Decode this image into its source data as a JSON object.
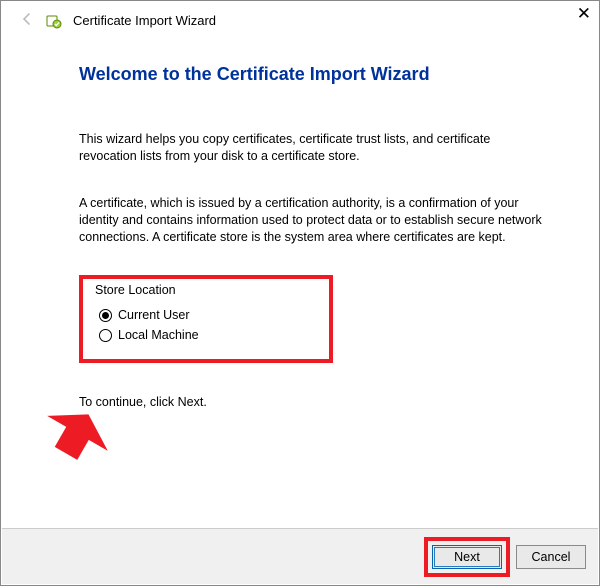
{
  "window": {
    "title": "Certificate Import Wizard"
  },
  "main": {
    "heading": "Welcome to the Certificate Import Wizard",
    "para1": "This wizard helps you copy certificates, certificate trust lists, and certificate revocation lists from your disk to a certificate store.",
    "para2": "A certificate, which is issued by a certification authority, is a confirmation of your identity and contains information used to protect data or to establish secure network connections. A certificate store is the system area where certificates are kept.",
    "store_location": {
      "legend": "Store Location",
      "options": [
        {
          "label": "Current User",
          "selected": true
        },
        {
          "label": "Local Machine",
          "selected": false
        }
      ]
    },
    "continue_hint": "To continue, click Next."
  },
  "footer": {
    "next": "Next",
    "cancel": "Cancel"
  },
  "annotations": {
    "arrow_color": "#ed1c24",
    "highlight_color": "#ed1c24"
  }
}
